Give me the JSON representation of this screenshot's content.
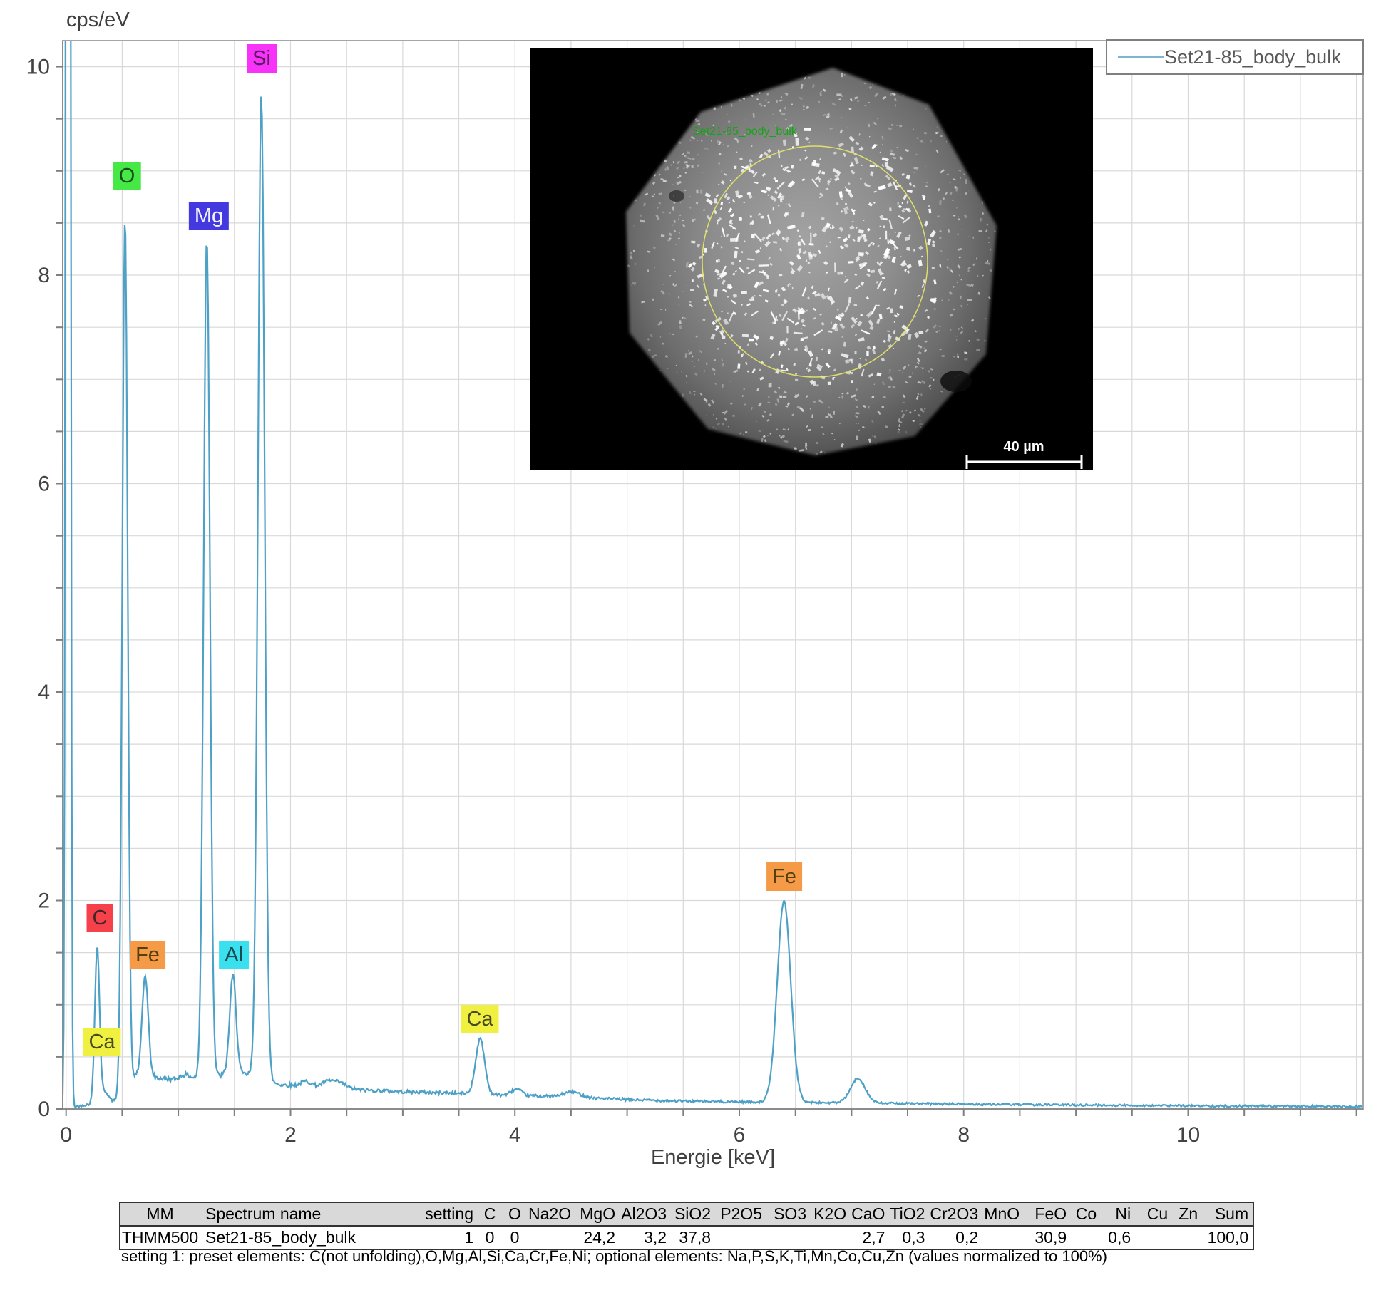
{
  "chart": {
    "y_unit_label": "cps/eV",
    "x_title": "Energie [keV]"
  },
  "legend": {
    "entry": "Set21-85_body_bulk"
  },
  "inset": {
    "region_label": "Set21-85_body_bulk",
    "scale_text": "40 µm"
  },
  "chart_data": {
    "type": "line",
    "title": "EDS spectrum Set21-85_body_bulk",
    "xlabel": "Energie [keV]",
    "ylabel": "cps/eV",
    "x_range": [
      -0.03,
      11.56
    ],
    "y_range": [
      0,
      10.25
    ],
    "x_tick_labels": [
      0,
      2,
      4,
      6,
      8,
      10
    ],
    "y_tick_labels": [
      0,
      2,
      4,
      6,
      8,
      10
    ],
    "minor_tick_step": 0.5,
    "grid": true,
    "legend_position": "top-right",
    "series_name": "Set21-85_body_bulk",
    "line_color": "#4da0c6",
    "peaks": [
      {
        "element": "zero-noise",
        "kev": 0.018,
        "amplitude": 45.0,
        "sigma": 0.014
      },
      {
        "element": "C",
        "line": "Ka",
        "kev": 0.277,
        "amplitude": 1.5,
        "sigma": 0.021
      },
      {
        "element": "Ca",
        "line": "L",
        "kev": 0.345,
        "amplitude": 0.1,
        "sigma": 0.03
      },
      {
        "element": "O",
        "line": "Ka",
        "kev": 0.525,
        "amplitude": 8.42,
        "sigma": 0.024
      },
      {
        "element": "Fe",
        "line": "L",
        "kev": 0.705,
        "amplitude": 0.97,
        "sigma": 0.027
      },
      {
        "element": "",
        "line": "",
        "kev": 1.05,
        "amplitude": 0.05,
        "sigma": 0.05
      },
      {
        "element": "Mg",
        "line": "Ka",
        "kev": 1.254,
        "amplitude": 8.05,
        "sigma": 0.028
      },
      {
        "element": "Al",
        "line": "Ka",
        "kev": 1.487,
        "amplitude": 0.95,
        "sigma": 0.029
      },
      {
        "element": "Si",
        "line": "Ka",
        "kev": 1.74,
        "amplitude": 9.42,
        "sigma": 0.03
      },
      {
        "element": "",
        "line": "",
        "kev": 2.14,
        "amplitude": 0.05,
        "sigma": 0.05
      },
      {
        "element": "",
        "line": "",
        "kev": 2.35,
        "amplitude": 0.07,
        "sigma": 0.06
      },
      {
        "element": "",
        "line": "",
        "kev": 2.46,
        "amplitude": 0.04,
        "sigma": 0.05
      },
      {
        "element": "Ca",
        "line": "Ka",
        "kev": 3.69,
        "amplitude": 0.53,
        "sigma": 0.04
      },
      {
        "element": "Ca",
        "line": "Kb",
        "kev": 4.013,
        "amplitude": 0.06,
        "sigma": 0.045
      },
      {
        "element": "",
        "line": "",
        "kev": 4.51,
        "amplitude": 0.05,
        "sigma": 0.07
      },
      {
        "element": "Fe",
        "line": "Ka",
        "kev": 6.398,
        "amplitude": 1.93,
        "sigma": 0.06
      },
      {
        "element": "Fe",
        "line": "Kb",
        "kev": 7.058,
        "amplitude": 0.235,
        "sigma": 0.065
      }
    ],
    "background_points": [
      [
        -0.03,
        0.01
      ],
      [
        0.08,
        0.02
      ],
      [
        0.15,
        0.035
      ],
      [
        0.3,
        0.06
      ],
      [
        0.42,
        0.075
      ],
      [
        0.55,
        0.15
      ],
      [
        0.62,
        0.33
      ],
      [
        0.8,
        0.3
      ],
      [
        1.0,
        0.27
      ],
      [
        1.2,
        0.3
      ],
      [
        1.45,
        0.33
      ],
      [
        1.65,
        0.33
      ],
      [
        1.9,
        0.235
      ],
      [
        2.2,
        0.21
      ],
      [
        2.6,
        0.185
      ],
      [
        3.0,
        0.165
      ],
      [
        3.5,
        0.15
      ],
      [
        4.0,
        0.13
      ],
      [
        4.5,
        0.115
      ],
      [
        5.0,
        0.09
      ],
      [
        5.5,
        0.075
      ],
      [
        6.0,
        0.068
      ],
      [
        6.6,
        0.062
      ],
      [
        7.2,
        0.055
      ],
      [
        7.8,
        0.048
      ],
      [
        8.5,
        0.042
      ],
      [
        9.5,
        0.034
      ],
      [
        10.5,
        0.028
      ],
      [
        11.56,
        0.024
      ]
    ],
    "peak_labels": [
      {
        "el": "C",
        "x": 0.3,
        "y": 1.83,
        "bg": "#f6404a",
        "fg": "#44262a"
      },
      {
        "el": "Ca",
        "x": 0.32,
        "y": 0.64,
        "bg": "#f0f041",
        "fg": "#4a4a22"
      },
      {
        "el": "Fe",
        "x": 0.725,
        "y": 1.475,
        "bg": "#f59a47",
        "fg": "#54400f"
      },
      {
        "el": "O",
        "x": 0.545,
        "y": 8.95,
        "bg": "#46e846",
        "fg": "#1d4a1d"
      },
      {
        "el": "Mg",
        "x": 1.27,
        "y": 8.57,
        "bg": "#4439de",
        "fg": "#f2f2ff"
      },
      {
        "el": "Al",
        "x": 1.495,
        "y": 1.475,
        "bg": "#3ae0ee",
        "fg": "#1c4a50"
      },
      {
        "el": "Si",
        "x": 1.745,
        "y": 10.08,
        "bg": "#f832f8",
        "fg": "#55205a"
      },
      {
        "el": "Ca",
        "x": 3.69,
        "y": 0.86,
        "bg": "#f0f041",
        "fg": "#4a4a22"
      },
      {
        "el": "Fe",
        "x": 6.4,
        "y": 2.23,
        "bg": "#f59a47",
        "fg": "#54400f"
      }
    ]
  },
  "table": {
    "headers": [
      "MM",
      "Spectrum name",
      "setting",
      "C",
      "O",
      "Na2O",
      "MgO",
      "Al2O3",
      "SiO2",
      "P2O5",
      "SO3",
      "K2O",
      "CaO",
      "TiO2",
      "Cr2O3",
      "MnO",
      "FeO",
      "Co",
      "Ni",
      "Cu",
      "Zn",
      "Sum"
    ],
    "rows": [
      [
        "THMM500",
        "Set21-85_body_bulk",
        "1",
        "0",
        "0",
        "",
        "24,2",
        "3,2",
        "37,8",
        "",
        "",
        "",
        "2,7",
        "0,3",
        "0,2",
        "",
        "30,9",
        "",
        "0,6",
        "",
        "",
        "100,0"
      ]
    ],
    "note": "setting 1: preset elements: C(not unfolding),O,Mg,Al,Si,Ca,Cr,Fe,Ni; optional elements: Na,P,S,K,Ti,Mn,Co,Cu,Zn (values normalized to 100%)"
  }
}
